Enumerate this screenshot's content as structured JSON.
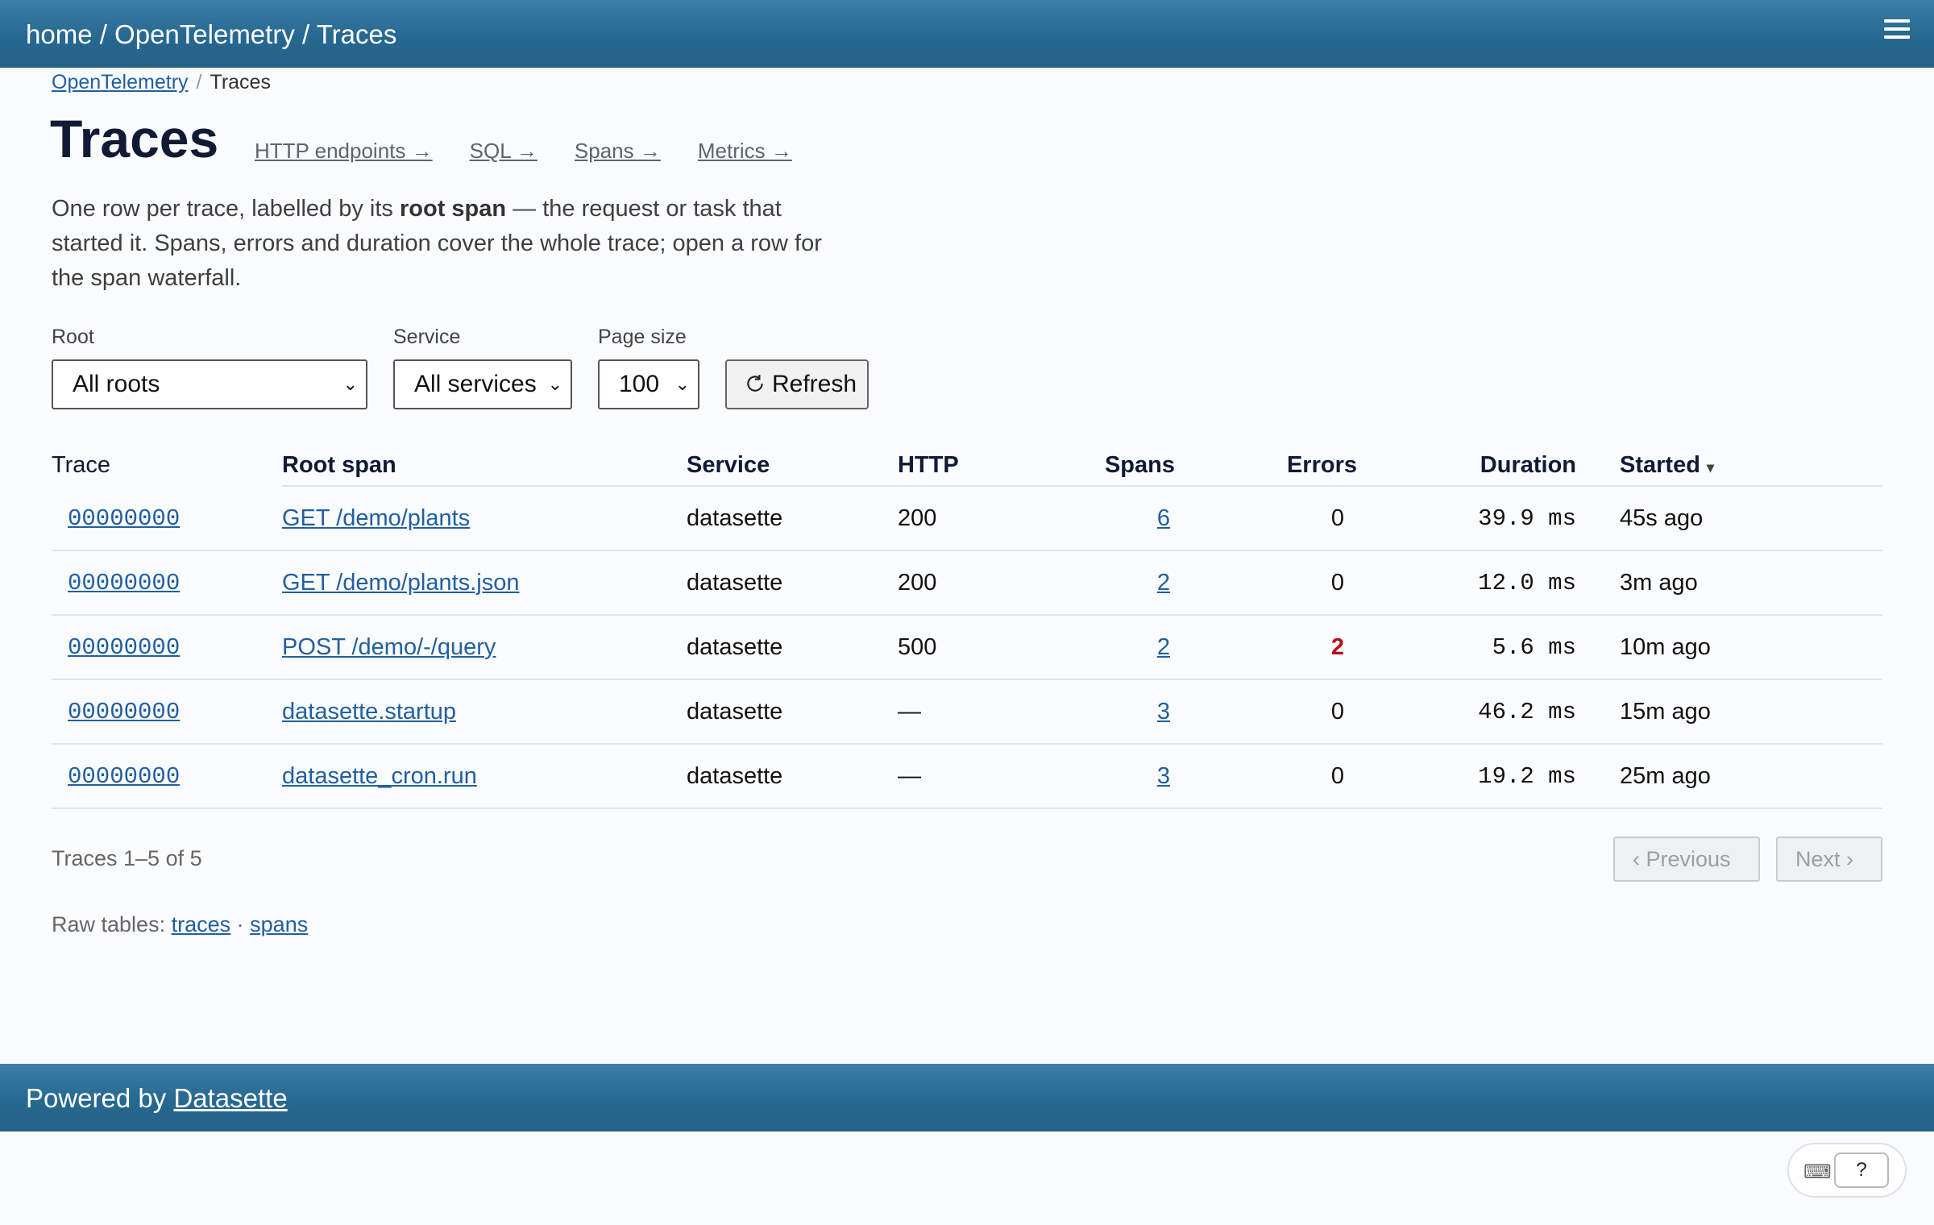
{
  "topbar": {
    "crumbs": "home / OpenTelemetry / Traces",
    "menu_icon": "hamburger-icon"
  },
  "breadcrumb": {
    "parent": "OpenTelemetry",
    "separator": "/",
    "current": "Traces"
  },
  "page": {
    "title": "Traces",
    "sublinks": [
      "HTTP endpoints →",
      "SQL →",
      "Spans →",
      "Metrics →"
    ],
    "description": {
      "before": "One row per trace, labelled by its ",
      "bold": "root span",
      "after": " — the request or task that started it. Spans, errors and duration cover the whole trace; open a row for the span waterfall."
    }
  },
  "filters": {
    "root": {
      "label": "Root",
      "value": "All roots"
    },
    "service": {
      "label": "Service",
      "value": "All services"
    },
    "page_size": {
      "label": "Page size",
      "value": "100"
    },
    "refresh_label": "Refresh",
    "refresh_icon": "refresh-icon"
  },
  "table": {
    "headers": [
      "Trace",
      "Root span",
      "Service",
      "HTTP",
      "Spans",
      "Errors",
      "Duration",
      "Started"
    ],
    "sort_indicator": "▾",
    "rows": [
      {
        "trace": "00000000",
        "root_span": "GET /demo/plants",
        "service": "datasette",
        "http": "200",
        "spans": "6",
        "errors": "0",
        "duration": "39.9 ms",
        "started": "45s ago"
      },
      {
        "trace": "00000000",
        "root_span": "GET /demo/plants.json",
        "service": "datasette",
        "http": "200",
        "spans": "2",
        "errors": "0",
        "duration": "12.0 ms",
        "started": "3m ago"
      },
      {
        "trace": "00000000",
        "root_span": "POST /demo/-/query",
        "service": "datasette",
        "http": "500",
        "spans": "2",
        "errors": "2",
        "duration": "5.6 ms",
        "started": "10m ago"
      },
      {
        "trace": "00000000",
        "root_span": "datasette.startup",
        "service": "datasette",
        "http": "—",
        "spans": "3",
        "errors": "0",
        "duration": "46.2 ms",
        "started": "15m ago"
      },
      {
        "trace": "00000000",
        "root_span": "datasette_cron.run",
        "service": "datasette",
        "http": "—",
        "spans": "3",
        "errors": "0",
        "duration": "19.2 ms",
        "started": "25m ago"
      }
    ],
    "error_color": "#c00018"
  },
  "pagination": {
    "count": "Traces 1–5 of 5",
    "previous": "‹ Previous",
    "next": "Next ›"
  },
  "raw_tables": {
    "label": "Raw tables:",
    "traces": "traces",
    "dot": "·",
    "spans": "spans"
  },
  "footer": {
    "prefix": "Powered by ",
    "link": "Datasette"
  },
  "help_widget": {
    "keyboard_icon": "keyboard-icon",
    "question": "?"
  },
  "colors": {
    "header": "#276890",
    "link": "#215fa0",
    "text": "#111a35"
  }
}
